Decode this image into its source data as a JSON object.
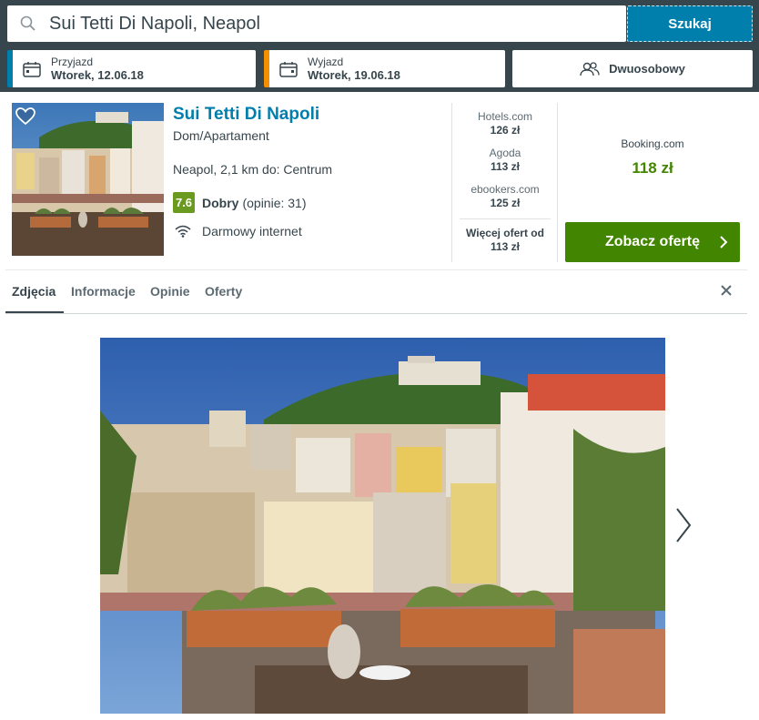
{
  "search": {
    "query": "Sui Tetti Di Napoli, Neapol",
    "button_label": "Szukaj"
  },
  "checkin": {
    "label": "Przyjazd",
    "date": "Wtorek, 12.06.18"
  },
  "checkout": {
    "label": "Wyjazd",
    "date": "Wtorek, 19.06.18"
  },
  "guests": {
    "label": "Dwuosobowy"
  },
  "hotel": {
    "name": "Sui Tetti Di Napoli",
    "type": "Dom/Apartament",
    "location": "Neapol, 2,1 km do: Centrum",
    "rating_score": "7.6",
    "rating_word": "Dobry",
    "rating_reviews": "(opinie: 31)",
    "amenity": "Darmowy internet"
  },
  "offers": [
    {
      "provider": "Hotels.com",
      "price": "126 zł"
    },
    {
      "provider": "Agoda",
      "price": "113 zł"
    },
    {
      "provider": "ebookers.com",
      "price": "125 zł"
    }
  ],
  "more_offers": {
    "label": "Więcej ofert od",
    "price": "113 zł"
  },
  "best_offer": {
    "provider": "Booking.com",
    "price": "118 zł",
    "button_label": "Zobacz ofertę"
  },
  "tabs": [
    {
      "label": "Zdjęcia"
    },
    {
      "label": "Informacje"
    },
    {
      "label": "Opinie"
    },
    {
      "label": "Oferty"
    }
  ],
  "colors": {
    "header_bg": "#37454d",
    "accent_blue": "#007fad",
    "accent_orange": "#f48f00",
    "deal_green": "#428500",
    "rating_green": "#6a9a1f"
  }
}
